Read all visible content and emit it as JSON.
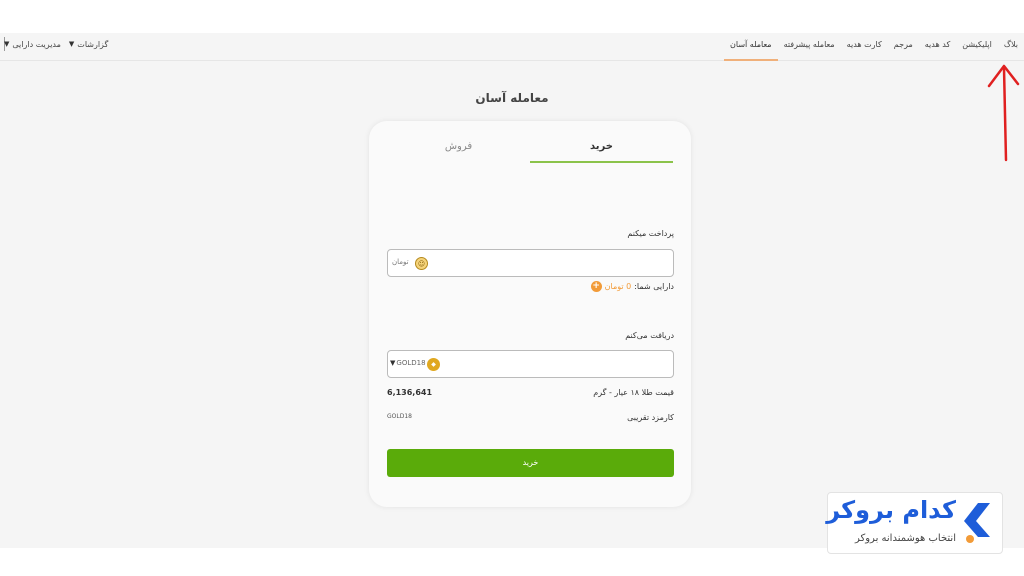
{
  "nav": {
    "items": [
      "معامله آسان",
      "معامله پیشرفته",
      "کارت هدیه",
      "مرجم",
      "کد هدیه",
      "اپلیکیشن",
      "بلاگ"
    ],
    "active_index": 0,
    "left": {
      "reports": "گزارشات",
      "asset_management": "مدیریت دارایی"
    }
  },
  "page_title": "معامله آسان",
  "trade": {
    "tabs": {
      "buy": "خرید",
      "sell": "فروش",
      "active": "buy"
    },
    "pay_label": "پرداخت میکنم",
    "pay_currency": "تومان",
    "balance_label": "دارایی شما:",
    "balance_value": "0 تومان",
    "receive_label": "دریافت می‌کنم",
    "receive_asset": "GOLD18",
    "price_label": "قیمت طلا ۱۸ عیار - گرم",
    "price_value": "6,136,641",
    "fee_label": "کارمزد تقریبی",
    "fee_value": "GOLD18",
    "buy_button": "خرید"
  },
  "watermark": {
    "title": "کدام بروکر",
    "subtitle": "انتخاب هوشمندانه بروکر"
  },
  "colors": {
    "accent_green": "#5aab0a",
    "annotation_red": "#e02020",
    "brand_blue": "#1e5dd9",
    "balance_orange": "#f29b38"
  }
}
